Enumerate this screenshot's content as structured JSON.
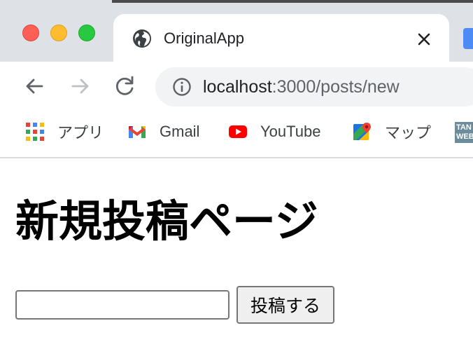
{
  "tab": {
    "title": "OriginalApp",
    "favicon": "globe-icon"
  },
  "address_bar": {
    "host": "localhost",
    "path": ":3000/posts/new"
  },
  "bookmarks": [
    {
      "label": "アプリ",
      "icon": "apps-grid-icon"
    },
    {
      "label": "Gmail",
      "icon": "gmail-icon"
    },
    {
      "label": "YouTube",
      "icon": "youtube-icon"
    },
    {
      "label": "マップ",
      "icon": "maps-icon"
    },
    {
      "label": "TAN WEB",
      "icon": "tan-web-icon"
    }
  ],
  "page": {
    "title": "新規投稿ページ",
    "input_value": "",
    "submit_label": "投稿する"
  },
  "colors": {
    "tabstrip": "#dee1e6",
    "omnibox": "#f1f3f4",
    "close_light": "#ff5f57",
    "minimize_light": "#febc2e",
    "maximize_light": "#28c840",
    "youtube_red": "#ff0000"
  }
}
